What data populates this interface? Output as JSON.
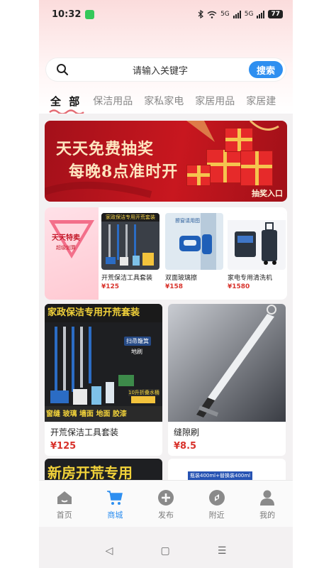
{
  "status": {
    "time": "10:32",
    "network": "5G",
    "battery": "77"
  },
  "search": {
    "placeholder": "请输入关键字",
    "button": "搜索"
  },
  "tabs": [
    "全 部",
    "保洁用品",
    "家私家电",
    "家居用品",
    "家居建"
  ],
  "banner": {
    "line1": "天天免费抽奖",
    "line2": "每晚8点准时开",
    "entry": "抽奖入口"
  },
  "special": {
    "promo_title": "天天特卖",
    "promo_sub": "超级划算",
    "items": [
      {
        "name": "开荒保洁工具套装",
        "price": "¥125",
        "img_text": "家政保洁专用开荒套装"
      },
      {
        "name": "双面玻璃擦",
        "price": "¥158",
        "img_text": "擦窗请用图"
      },
      {
        "name": "家电专用清洗机",
        "price": "¥1580",
        "img_text": ""
      }
    ]
  },
  "products": [
    {
      "name": "开荒保洁工具套装",
      "price": "¥125",
      "img_title": "家政保洁专用开荒套装",
      "img_tag1": "扫帚簸箕",
      "img_tag2": "地刷",
      "img_tag3": "10升折叠水桶",
      "img_bottom": "窗缝 玻璃 墙面 地面 胶漆"
    },
    {
      "name": "缝隙刷",
      "price": "¥8.5"
    }
  ],
  "peek": [
    {
      "text": "新房开荒专用"
    },
    {
      "text": "瓶装400ml+替换装400ml"
    }
  ],
  "nav": [
    {
      "label": "首页",
      "icon": "home-icon"
    },
    {
      "label": "商城",
      "icon": "cart-icon",
      "active": true
    },
    {
      "label": "发布",
      "icon": "plus-icon"
    },
    {
      "label": "附近",
      "icon": "compass-icon"
    },
    {
      "label": "我的",
      "icon": "user-icon"
    }
  ],
  "sys": {
    "back": "◁",
    "home": "▢",
    "menu": "☰"
  },
  "colors": {
    "accent": "#2e8ff0",
    "price": "#d8322b",
    "banner": "#c8171f"
  }
}
